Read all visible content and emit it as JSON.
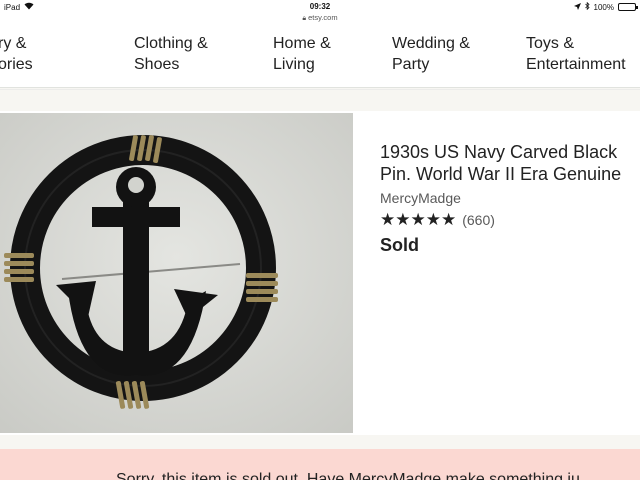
{
  "status_bar": {
    "device": "iPad",
    "time": "09:32",
    "url": "etsy.com",
    "battery": "100%",
    "battery_level": 1.0
  },
  "categories": [
    {
      "line1": "ry &",
      "line2": "ories"
    },
    {
      "line1": "Clothing &",
      "line2": "Shoes"
    },
    {
      "line1": "Home &",
      "line2": "Living"
    },
    {
      "line1": "Wedding &",
      "line2": "Party"
    },
    {
      "line1": "Toys &",
      "line2": "Entertainment"
    }
  ],
  "listing": {
    "title_line1": "1930s US Navy Carved Black",
    "title_line2": "Pin. World War II Era Genuine",
    "shop": "MercyMadge",
    "stars": "★★★★★",
    "rating_value": 5,
    "review_count": "(660)",
    "status": "Sold",
    "image_icon": "anchor-brooch-photo"
  },
  "banner": {
    "message": "Sorry, this item is sold out. Have MercyMadge make something ju..."
  },
  "colors": {
    "banner_bg": "#fbd8d2",
    "page_bg": "#f7f6f2",
    "photo_bg": "#d7d8d3"
  }
}
